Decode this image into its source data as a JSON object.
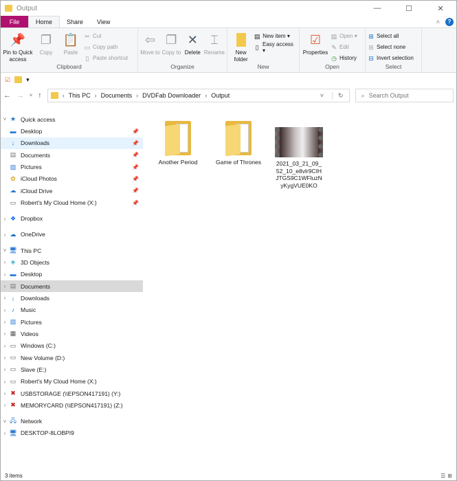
{
  "window": {
    "title": "Output",
    "minimize": "—",
    "maximize": "☐",
    "close": "✕"
  },
  "tabs": [
    "File",
    "Home",
    "Share",
    "View"
  ],
  "ribbon": {
    "clipboard": {
      "label": "Clipboard",
      "pin": "Pin to Quick access",
      "copy": "Copy",
      "paste": "Paste",
      "cut": "Cut",
      "copy_path": "Copy path",
      "paste_shortcut": "Paste shortcut"
    },
    "organize": {
      "label": "Organize",
      "move_to": "Move to",
      "copy_to": "Copy to",
      "delete": "Delete",
      "rename": "Rename"
    },
    "new": {
      "label": "New",
      "new_folder": "New folder",
      "new_item": "New item ▾",
      "easy_access": "Easy access ▾"
    },
    "open": {
      "label": "Open",
      "properties": "Properties",
      "open": "Open ▾",
      "edit": "Edit",
      "history": "History"
    },
    "select": {
      "label": "Select",
      "select_all": "Select all",
      "select_none": "Select none",
      "invert": "Invert selection"
    }
  },
  "address": {
    "crumbs": [
      "This PC",
      "Documents",
      "DVDFab Downloader",
      "Output"
    ],
    "search_placeholder": "Search Output"
  },
  "sidebar": {
    "quick_access": {
      "label": "Quick access",
      "items": [
        "Desktop",
        "Downloads",
        "Documents",
        "Pictures",
        "iCloud Photos",
        "iCloud Drive",
        "Robert's My Cloud Home (X:)"
      ]
    },
    "dropbox": "Dropbox",
    "onedrive": "OneDrive",
    "this_pc": {
      "label": "This PC",
      "items": [
        "3D Objects",
        "Desktop",
        "Documents",
        "Downloads",
        "Music",
        "Pictures",
        "Videos",
        "Windows (C:)",
        "New Volume (D:)",
        "Slave (E:)",
        "Robert's My Cloud Home (X:)",
        "USBSTORAGE (\\\\EPSON417191) (Y:)",
        "MEMORYCARD (\\\\EPSON417191) (Z:)"
      ]
    },
    "network": {
      "label": "Network",
      "items": [
        "DESKTOP-8LOBPI9"
      ]
    }
  },
  "files": [
    {
      "name": "Another Period",
      "type": "folder"
    },
    {
      "name": "Game of Thrones",
      "type": "folder"
    },
    {
      "name": "2021_03_21_09_52_10_e8vlr9CIHJTGS9C1WFluzNyKygVUE0KO",
      "type": "video"
    }
  ],
  "status": {
    "count": "3 items"
  }
}
